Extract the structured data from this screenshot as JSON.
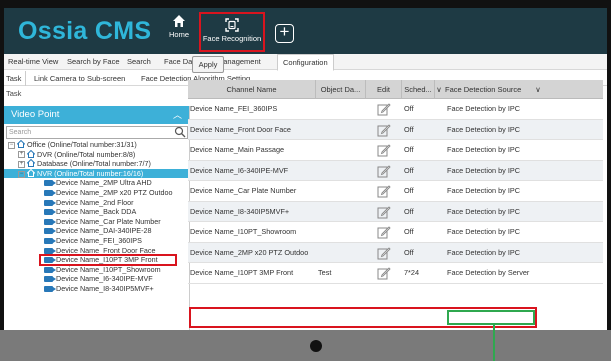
{
  "app": {
    "title": "Ossia CMS",
    "nav_home": "Home",
    "nav_face": "Face Recognition",
    "nav_add": "+"
  },
  "menu": [
    "Real-time View",
    "Search by Face",
    "Search",
    "Face Database Management",
    "Configuration"
  ],
  "subtabs": [
    "Task",
    "Link Camera to Sub-screen",
    "Face Detection Algorithm Setting"
  ],
  "section_label": "Task",
  "sidebar": {
    "title": "Video Point",
    "search_placeholder": "Search",
    "tree": [
      {
        "label": "Office (Online/Total number:31/31)",
        "type": "group",
        "exp": "⊟"
      },
      {
        "label": "DVR (Online/Total number:8/8)",
        "type": "group",
        "exp": "⊞"
      },
      {
        "label": "Database (Online/Total number:7/7)",
        "type": "group",
        "exp": "⊞"
      },
      {
        "label": "NVR (Online/Total number:16/16)",
        "type": "group",
        "exp": "⊟"
      },
      {
        "label": "Device Name_2MP Ultra AHD",
        "type": "device"
      },
      {
        "label": "Device Name_2MP x20 PTZ Outdoo",
        "type": "device"
      },
      {
        "label": "Device Name_2nd Floor",
        "type": "device"
      },
      {
        "label": "Device Name_Back DDA",
        "type": "device"
      },
      {
        "label": "Device Name_Car Plate Number",
        "type": "device"
      },
      {
        "label": "Device Name_DAI-340IPE-28",
        "type": "device"
      },
      {
        "label": "Device Name_FEI_360IPS",
        "type": "device"
      },
      {
        "label": "Device Name_Front Door Face",
        "type": "device"
      },
      {
        "label": "Device Name_I10PT 3MP Front",
        "type": "device"
      },
      {
        "label": "Device Name_I10PT_Showroom",
        "type": "device"
      },
      {
        "label": "Device Name_I6-340IPE-MVF",
        "type": "device"
      },
      {
        "label": "Device Name_I8-340IP5MVF+",
        "type": "device"
      }
    ]
  },
  "apply_label": "Apply",
  "table": {
    "headers": [
      "Channel Name",
      "Object Da...",
      "Edit",
      "Sched...",
      "Face Detection Source"
    ],
    "rows": [
      {
        "channel": "Device Name_FEI_360IPS",
        "object": "",
        "schedule": "Off",
        "source": "Face Detection by IPC"
      },
      {
        "channel": "Device Name_Front Door Face",
        "object": "",
        "schedule": "Off",
        "source": "Face Detection by IPC"
      },
      {
        "channel": "Device Name_Main Passage",
        "object": "",
        "schedule": "Off",
        "source": "Face Detection by IPC"
      },
      {
        "channel": "Device Name_I6-340IPE-MVF",
        "object": "",
        "schedule": "Off",
        "source": "Face Detection by IPC"
      },
      {
        "channel": "Device Name_Car Plate Number",
        "object": "",
        "schedule": "Off",
        "source": "Face Detection by IPC"
      },
      {
        "channel": "Device Name_I8-340IP5MVF+",
        "object": "",
        "schedule": "Off",
        "source": "Face Detection by IPC"
      },
      {
        "channel": "Device Name_I10PT_Showroom",
        "object": "",
        "schedule": "Off",
        "source": "Face Detection by IPC"
      },
      {
        "channel": "Device Name_2MP x20 PTZ Outdoo",
        "object": "",
        "schedule": "Off",
        "source": "Face Detection by IPC"
      },
      {
        "channel": "Device Name_I10PT 3MP Front",
        "object": "Test",
        "schedule": "7*24",
        "source": "Face Detection by Server"
      }
    ]
  },
  "colors": {
    "accent": "#3db0d8",
    "topbar": "#1e3a44",
    "highlight_red": "#d9141e",
    "highlight_green": "#2fa84f"
  }
}
